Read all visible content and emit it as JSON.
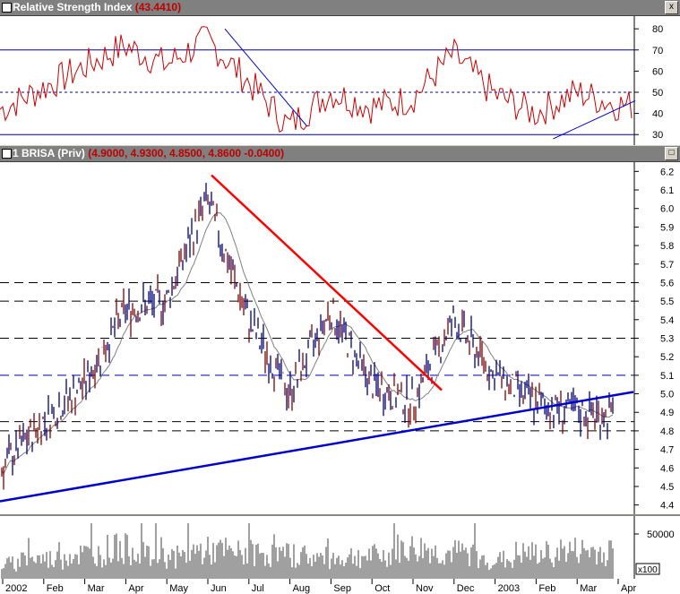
{
  "rsi_panel": {
    "title": "Relative Strength Index",
    "value": "(43.4410)",
    "close_symbol": "x"
  },
  "price_panel": {
    "title": "1 BRISA (Priv)",
    "value": "(4.9000, 4.9300, 4.8500, 4.8600 -0.0400)",
    "max_symbol": "□"
  },
  "volume_panel": {
    "multiplier_label": "x100"
  },
  "colors": {
    "price_bar": "#000080",
    "down_bar": "#800000",
    "rsi_line": "#cc0000",
    "red_trendline": "#ff0000",
    "blue_trendline": "#0000cc",
    "volume_bar": "#808080",
    "moving_average": "#808080"
  },
  "chart_data": [
    {
      "type": "line",
      "title": "Relative Strength Index",
      "series": [
        {
          "name": "Relative Strength Index",
          "last_value": 43.441
        }
      ],
      "x": [
        "2002-01",
        "2002-02",
        "2002-03",
        "2002-04",
        "2002-05",
        "2002-06",
        "2002-07",
        "2002-08",
        "2002-09",
        "2002-10",
        "2002-11",
        "2002-12",
        "2003-01",
        "2003-02",
        "2003-03",
        "2003-04"
      ],
      "values": [
        42,
        52,
        62,
        72,
        63,
        75,
        55,
        34,
        50,
        43,
        47,
        68,
        49,
        40,
        50,
        44
      ],
      "y_ticks": [
        30,
        40,
        50,
        60,
        70,
        80
      ],
      "ylim": [
        25,
        86
      ],
      "reference_lines": [
        30,
        50,
        70
      ],
      "trendlines": [
        {
          "from": [
            "2002-06",
            80
          ],
          "to": [
            "2002-08",
            34
          ],
          "color": "blue"
        },
        {
          "from": [
            "2003-02",
            28
          ],
          "to": [
            "2003-04",
            46
          ],
          "color": "blue"
        }
      ],
      "grid": false
    },
    {
      "type": "bar",
      "subtype": "ohlc",
      "title": "1 BRISA (Priv)",
      "last": {
        "open": 4.9,
        "high": 4.93,
        "low": 4.85,
        "close": 4.86,
        "change": -0.04
      },
      "x": [
        "2002-01",
        "2002-02",
        "2002-03",
        "2002-04",
        "2002-05",
        "2002-06",
        "2002-07",
        "2002-08",
        "2002-09",
        "2002-10",
        "2002-11",
        "2002-12",
        "2003-01",
        "2003-02",
        "2003-03",
        "2003-04"
      ],
      "values": [
        4.6,
        4.85,
        5.05,
        5.45,
        5.5,
        6.05,
        5.4,
        5.0,
        5.45,
        5.05,
        4.95,
        5.4,
        5.1,
        4.95,
        4.9,
        4.88
      ],
      "y_ticks": [
        4.4,
        4.5,
        4.6,
        4.7,
        4.8,
        4.9,
        5.0,
        5.1,
        5.2,
        5.3,
        5.4,
        5.5,
        5.6,
        5.7,
        5.8,
        5.9,
        6.0,
        6.1,
        6.2
      ],
      "ylim": [
        4.35,
        6.25
      ],
      "horizontal_lines": [
        4.8,
        4.85,
        5.1,
        5.3,
        5.5,
        5.6
      ],
      "trendlines": [
        {
          "from": [
            "2002-06",
            6.18
          ],
          "to": [
            "2002-11",
            5.02
          ],
          "color": "red"
        },
        {
          "from": [
            "2002-01",
            4.42
          ],
          "to": [
            "2003-04",
            5.01
          ],
          "color": "blue"
        }
      ],
      "moving_average": true,
      "grid": false
    },
    {
      "type": "bar",
      "title": "",
      "x": [
        "2002-01",
        "2002-02",
        "2002-03",
        "2002-04",
        "2002-05",
        "2002-06",
        "2002-07",
        "2002-08",
        "2002-09",
        "2002-10",
        "2002-11",
        "2002-12",
        "2003-01",
        "2003-02",
        "2003-03",
        "2003-04"
      ],
      "values": [
        150,
        200,
        250,
        300,
        220,
        280,
        260,
        240,
        210,
        230,
        300,
        260,
        190,
        250,
        280,
        270
      ],
      "y_ticks": [
        50000
      ],
      "units": "x100"
    }
  ],
  "x_axis_labels": [
    "2002",
    "Feb",
    "Mar",
    "Apr",
    "May",
    "Jun",
    "Jul",
    "Aug",
    "Sep",
    "Oct",
    "Nov",
    "Dec",
    "2003",
    "Feb",
    "Mar",
    "Apr"
  ]
}
